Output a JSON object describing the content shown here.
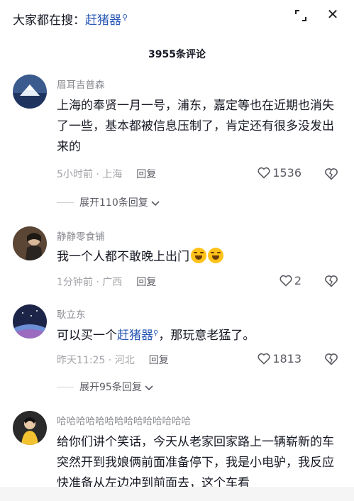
{
  "header": {
    "search_prefix": "大家都在搜：",
    "search_keyword": "赶猪器",
    "search_icon": "search-icon",
    "expand_icon": "expand-icon",
    "close_icon": "close-icon"
  },
  "comment_count_label": "3955条评论",
  "comments": [
    {
      "username": "眉耳吉普森",
      "text": "上海的奉贤一月一号，浦东，嘉定等也在近期也消失了一些，基本都被信息压制了，肯定还有很多没发出来的",
      "time": "5小时前",
      "location": "上海",
      "reply_label": "回复",
      "likes": "1536",
      "expand_label": "展开110条回复"
    },
    {
      "username": "静静零食铺",
      "text": "我一个人都不敢晚上出门",
      "emoji": "laughing-crying-emoji",
      "time": "1分钟前",
      "location": "广西",
      "reply_label": "回复",
      "likes": "2"
    },
    {
      "username": "耿立东",
      "text_before": "可以买一个",
      "text_link": "赶猪器",
      "text_after": "，那玩意老猛了。",
      "time": "昨天11:25",
      "location": "河北",
      "reply_label": "回复",
      "likes": "1813",
      "expand_label": "展开95条回复"
    },
    {
      "username": "哈哈哈哈哈哈哈哈哈哈哈哈哈哈",
      "text": "给你们讲个笑话，今天从老家回家路上一辆崭新的车突然开到我娘俩前面准备停下，我是小电驴，我反应快准备从左边冲到前面去，这个车看"
    }
  ],
  "colors": {
    "link": "#2a59b5",
    "secondary_text": "#8a8b91",
    "primary_text": "#161823"
  }
}
